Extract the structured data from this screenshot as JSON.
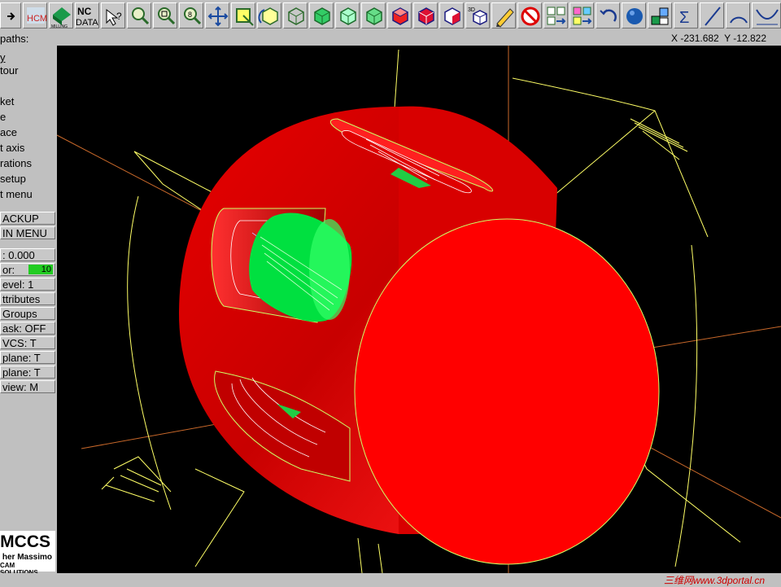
{
  "toolbar": {
    "icons": [
      "arrow-right-icon",
      "hcm-icon",
      "nc-mill-icon",
      "nc-data-icon",
      "query-icon",
      "zoom-icon",
      "zoom-window-icon",
      "zoom-step-icon",
      "pan-icon",
      "fit-icon",
      "rotate-icon",
      "cube-wire-icon",
      "cube-green-icon",
      "cube-iso-icon",
      "cube-alt-icon",
      "cube-red-icon",
      "cube-solid-icon",
      "cube-white-icon",
      "cube-3d-icon",
      "pencil-icon",
      "no-icon",
      "layout-icon",
      "layout-color-icon",
      "undo-icon",
      "sphere-icon",
      "stack-icon",
      "sigma-icon",
      "line-icon",
      "arc-icon",
      "curve-icon"
    ],
    "hcm_label": "HCM",
    "nc_label": "NC",
    "data_label": "DATA",
    "mill_label": "MILLING",
    "cube3d_label": "3D"
  },
  "status": {
    "label": "paths:",
    "coords": "X -231.682  Y -12.822"
  },
  "sidebar": {
    "menu": [
      "y",
      "tour",
      "",
      "ket",
      "e",
      "ace",
      "t axis",
      "rations",
      "setup",
      "t menu"
    ],
    "backup": "ACKUP",
    "main_menu": "IN MENU",
    "z_value": ":  0.000",
    "color_label": "or:",
    "color_value": "10",
    "level": "evel:  1",
    "attributes": "ttributes",
    "groups": "Groups",
    "mask": "ask:  OFF",
    "wcs": "VCS:  T",
    "tplane": "plane:  T",
    "cplane": "plane:  T",
    "view": "view:   M"
  },
  "logo": {
    "name": "MCCS",
    "line1": "her Massimo",
    "line2": "CAM SOLUTIONS"
  },
  "watermark": "三维网www.3dportal.cn",
  "colors": {
    "part_red": "#ff0000",
    "toolpath_green": "#00ff00",
    "wireframe_yellow": "#ffff66",
    "axis_orange": "#d2691e",
    "background": "#000000",
    "chrome": "#c0c0c0"
  }
}
